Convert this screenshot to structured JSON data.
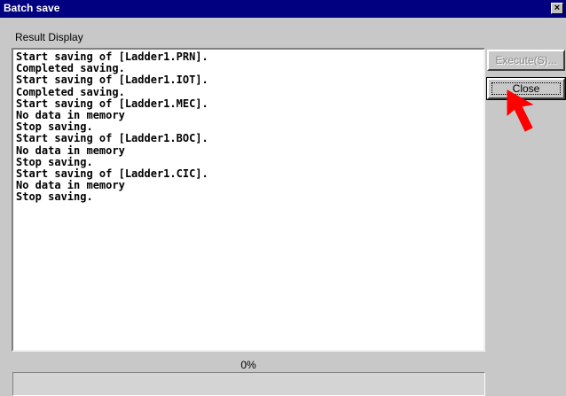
{
  "window": {
    "title": "Batch save",
    "close_glyph": "×"
  },
  "result_display": {
    "label": "Result Display",
    "lines": [
      "Start saving of [Ladder1.PRN].",
      "Completed saving.",
      "Start saving of [Ladder1.IOT].",
      "Completed saving.",
      "Start saving of [Ladder1.MEC].",
      "No data in memory",
      "Stop saving.",
      "Start saving of [Ladder1.BOC].",
      "No data in memory",
      "Stop saving.",
      "Start saving of [Ladder1.CIC].",
      "No data in memory",
      "Stop saving."
    ]
  },
  "buttons": {
    "execute_label": "Execute(S)...",
    "close_label": "Close"
  },
  "progress": {
    "label": "0%",
    "value": 0
  },
  "colors": {
    "titlebar": "#000080",
    "window_bg": "#c8c8c8",
    "cursor": "#ff0000"
  },
  "icons": {
    "window_close": "close-icon",
    "pointer": "mouse-pointer-icon"
  }
}
